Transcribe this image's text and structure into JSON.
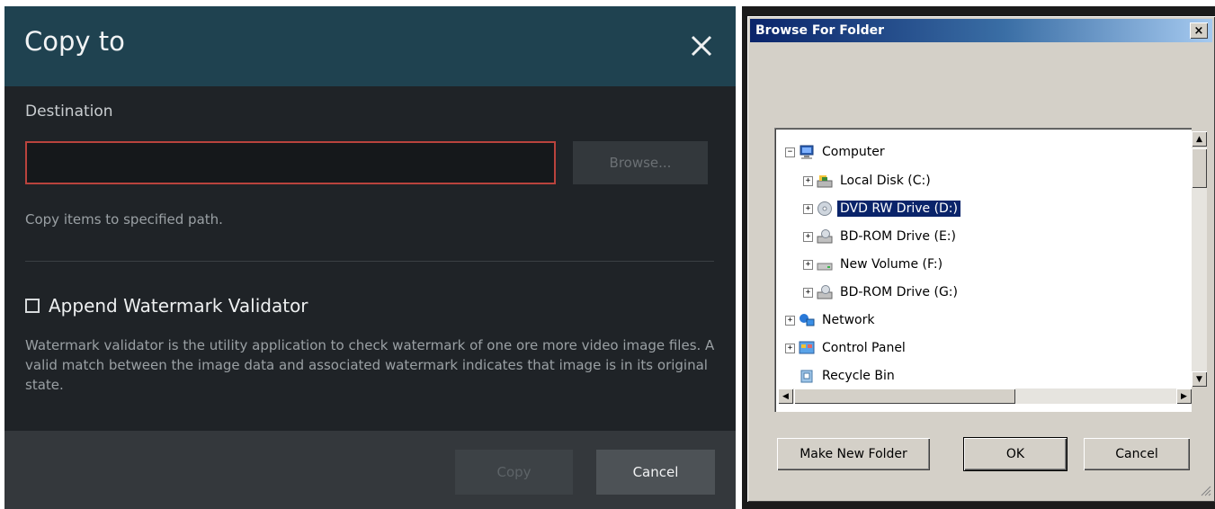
{
  "copy_dialog": {
    "title": "Copy to",
    "destination_label": "Destination",
    "destination_value": "",
    "browse_label": "Browse...",
    "help_text": "Copy items to specified path.",
    "watermark_label": "Append Watermark Validator",
    "watermark_checked": false,
    "watermark_description": "Watermark validator is the utility application to check watermark of one ore more video image files. A valid match between the image data and associated watermark indicates that image is in its original state.",
    "copy_label": "Copy",
    "cancel_label": "Cancel",
    "colors": {
      "header": "#1f4250",
      "body": "#1f2327",
      "input_border_error": "#b9433d",
      "footer": "#34383c"
    }
  },
  "browse_dialog": {
    "title": "Browse For Folder",
    "close_glyph": "×",
    "tree": [
      {
        "label": "Computer",
        "expander": "−",
        "icon": "computer-icon"
      },
      {
        "label": "Local Disk (C:)",
        "expander": "+",
        "icon": "local-disk-icon"
      },
      {
        "label": "DVD RW Drive (D:)",
        "expander": "+",
        "icon": "dvd-drive-icon",
        "selected": true
      },
      {
        "label": "BD-ROM Drive (E:)",
        "expander": "+",
        "icon": "bd-rom-drive-icon"
      },
      {
        "label": "New Volume (F:)",
        "expander": "+",
        "icon": "volume-drive-icon"
      },
      {
        "label": "BD-ROM Drive (G:)",
        "expander": "+",
        "icon": "bd-rom-drive-icon"
      },
      {
        "label": "Network",
        "expander": "+",
        "icon": "network-icon"
      },
      {
        "label": "Control Panel",
        "expander": "+",
        "icon": "control-panel-icon"
      },
      {
        "label": "Recycle Bin",
        "expander": "",
        "icon": "recycle-bin-icon"
      }
    ],
    "make_new_folder_label": "Make New Folder",
    "ok_label": "OK",
    "cancel_label": "Cancel",
    "colors": {
      "titlebar_start": "#0a246a",
      "face": "#d4d0c8",
      "selection": "#0a246a"
    }
  }
}
